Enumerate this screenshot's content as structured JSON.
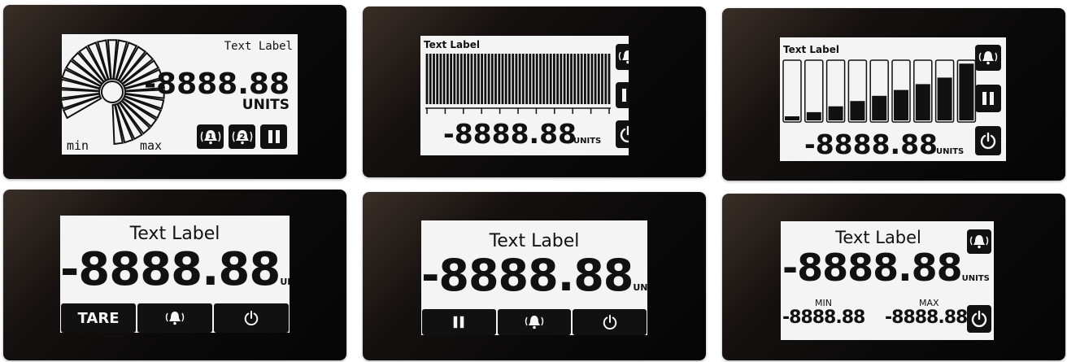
{
  "panels": {
    "gauge": {
      "label": "Text Label",
      "value": "-8888.88",
      "units": "UNITS",
      "min_label": "min",
      "max_label": "max",
      "alarm1": "1",
      "alarm2": "2"
    },
    "bargraph": {
      "label": "Text Label",
      "value": "-8888.88",
      "units": "UNITS"
    },
    "levels": {
      "label": "Text Label",
      "value": "-8888.88",
      "units": "UNITS",
      "level_fractions": [
        0.07,
        0.14,
        0.24,
        0.33,
        0.42,
        0.52,
        0.62,
        0.73,
        0.97
      ]
    },
    "tare": {
      "label": "Text Label",
      "value": "-8888.88",
      "units": "UNITS",
      "softkey_tare": "TARE"
    },
    "pause": {
      "label": "Text Label",
      "value": "-8888.88",
      "units": "UNITS"
    },
    "minmax": {
      "label": "Text Label",
      "value": "-8888.88",
      "units": "UNITS",
      "min_label": "MIN",
      "max_label": "MAX",
      "min_value": "-8888.88",
      "max_value": "-8888.88"
    }
  },
  "icons": [
    "bell-icon",
    "alarm-1-icon",
    "alarm-2-icon",
    "pause-icon",
    "power-icon"
  ],
  "colors": {
    "lcd": "#f4f4f4",
    "ink": "#111111",
    "bezel": "#0b0a0a"
  }
}
